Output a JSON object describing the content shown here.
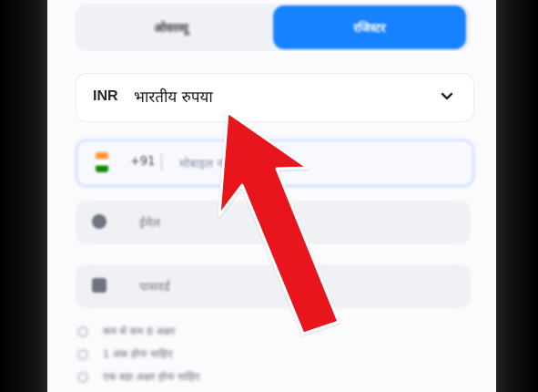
{
  "tabs": {
    "inactive_label": "ओवरव्यू",
    "active_label": "रजिस्टर"
  },
  "currency": {
    "code": "INR",
    "name": "भारतीय रुपया",
    "chevron_icon": "chevron-down-icon"
  },
  "form": {
    "phone": {
      "icon": "india-flag-icon",
      "code": "+91",
      "placeholder": "मोबाइल नंबर"
    },
    "email": {
      "icon": "circle-icon",
      "placeholder": "ईमेल"
    },
    "password": {
      "icon": "lock-icon",
      "placeholder": "पासवर्ड"
    }
  },
  "requirements": [
    "कम से कम 8 अक्षर",
    "1 अंक होना चाहिए",
    "एक बड़ा अक्षर होना चाहिए"
  ],
  "colors": {
    "primary": "#1782ff",
    "arrow_red": "#e8141c",
    "page_bg": "#fbfbfd"
  }
}
